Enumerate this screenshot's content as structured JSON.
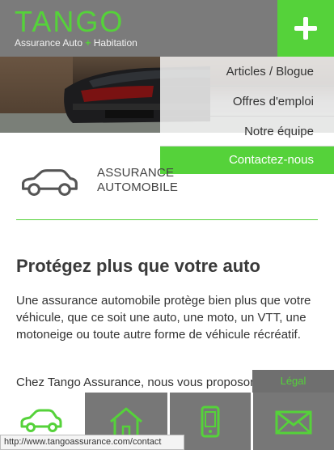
{
  "header": {
    "brand": "TANGO",
    "tagline_part1": "Assurance Auto",
    "tagline_plus": "+",
    "tagline_part2": "Habitation"
  },
  "menu": {
    "items": [
      {
        "label": "Articles / Blogue"
      },
      {
        "label": "Offres d'emploi"
      },
      {
        "label": "Notre équipe"
      },
      {
        "label": "Contactez-nous"
      }
    ]
  },
  "section": {
    "title": "ASSURANCE AUTOMOBILE",
    "heading": "Protégez plus que votre auto",
    "paragraph1": "Une assurance automobile protège bien plus que votre véhicule, que ce soit une auto, une moto, un VTT, une motoneige ou toute autre forme de véhicule récréatif.",
    "paragraph2": "Chez Tango Assurance, nous vous proposons"
  },
  "legal_label": "Légal",
  "bottom_nav": [
    {
      "icon": "car-icon"
    },
    {
      "icon": "house-icon"
    },
    {
      "icon": "phone-icon"
    },
    {
      "icon": "envelope-icon"
    }
  ],
  "status_bar": {
    "url": "http://www.tangoassurance.com/contact"
  },
  "colors": {
    "accent": "#55d23a",
    "header_bg": "#7b7b7b",
    "tile_bg": "#777777"
  }
}
